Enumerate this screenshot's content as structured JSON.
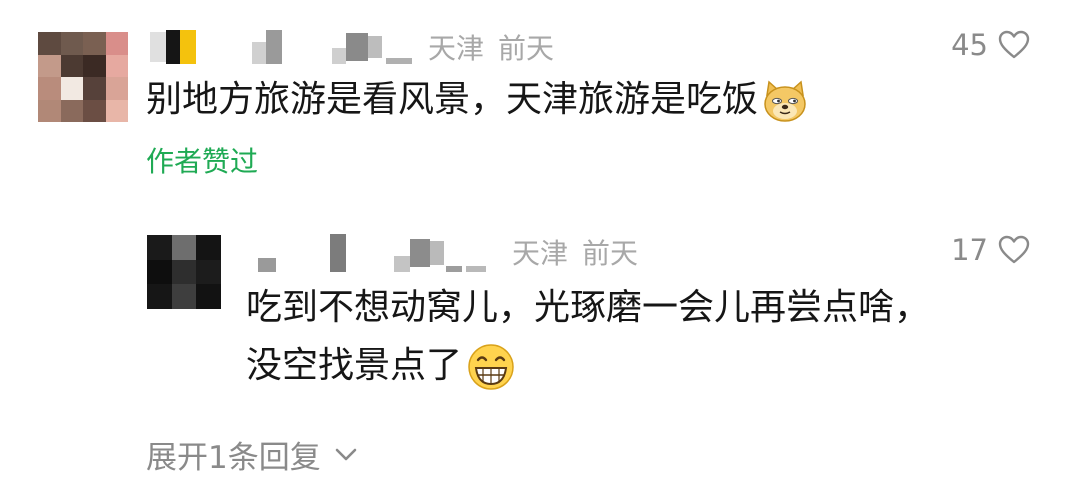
{
  "comments": [
    {
      "location": "天津",
      "time": "前天",
      "likes": "45",
      "text": "别地方旅游是看风景，天津旅游是吃饭",
      "emoji": "doge-face-icon",
      "author_liked": "作者赞过"
    }
  ],
  "reply": {
    "location": "天津",
    "time": "前天",
    "likes": "17",
    "text_line1": "吃到不想动窝儿，光琢磨一会儿再尝点啥，",
    "text_line2": "没空找景点了",
    "emoji": "grinning-face-icon"
  },
  "expand": {
    "label": "展开1条回复"
  },
  "colors": {
    "accent_green": "#1faa54",
    "meta_gray": "#a8a8a8"
  }
}
